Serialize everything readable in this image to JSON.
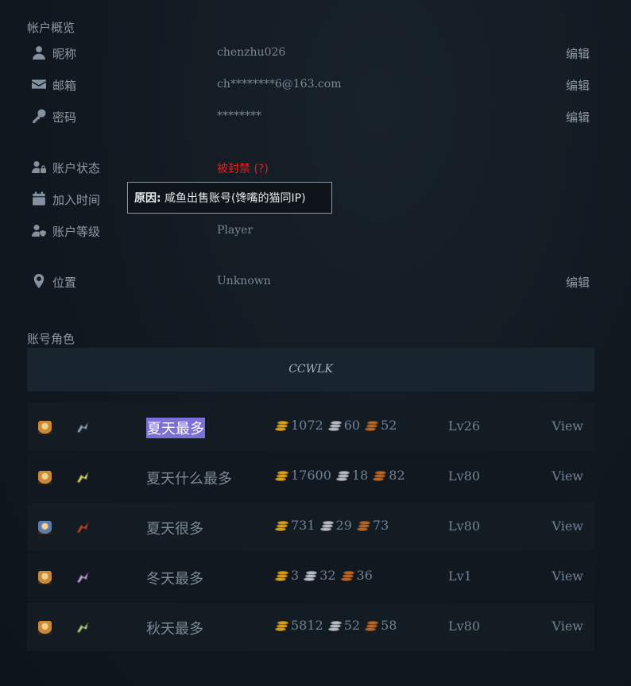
{
  "overview": {
    "title": "帐户概览",
    "rows": [
      {
        "label": "昵称",
        "value": "chenzhu026",
        "edit": "编辑",
        "icon": "user-icon"
      },
      {
        "label": "邮箱",
        "value": "ch********6@163.com",
        "edit": "编辑",
        "icon": "envelope-icon"
      },
      {
        "label": "密码",
        "value": "********",
        "edit": "编辑",
        "icon": "key-icon"
      }
    ],
    "status": {
      "label": "账户状态",
      "value": "被封禁 (?)",
      "icon": "user-lock-icon",
      "color": "#e2201e"
    },
    "joined": {
      "label": "加入时间",
      "icon": "calendar-icon"
    },
    "level": {
      "label": "账户等级",
      "value": "Player",
      "icon": "user-shield-icon"
    },
    "location": {
      "label": "位置",
      "value": "Unknown",
      "edit": "编辑",
      "icon": "map-marker-icon"
    }
  },
  "tooltip": {
    "prefix": "原因:",
    "text": " 咸鱼出售账号(馋嘴的猫同IP)"
  },
  "characters": {
    "title": "账号角色",
    "realm": "CCWLK",
    "list": [
      {
        "name": "夏天最多",
        "gold": "1072",
        "silver": "60",
        "copper": "52",
        "level": "Lv26",
        "view": "View",
        "selected": true,
        "race_icon": "human-female-icon",
        "class_icon": "class-icon-1"
      },
      {
        "name": "夏天什么最多",
        "gold": "17600",
        "silver": "18",
        "copper": "82",
        "level": "Lv80",
        "view": "View",
        "race_icon": "human-female-icon",
        "class_icon": "class-icon-2"
      },
      {
        "name": "夏天很多",
        "gold": "731",
        "silver": "29",
        "copper": "73",
        "level": "Lv80",
        "view": "View",
        "race_icon": "draenei-icon",
        "class_icon": "class-icon-3"
      },
      {
        "name": "冬天最多",
        "gold": "3",
        "silver": "32",
        "copper": "36",
        "level": "Lv1",
        "view": "View",
        "race_icon": "human-female-icon",
        "class_icon": "class-icon-4"
      },
      {
        "name": "秋天最多",
        "gold": "5812",
        "silver": "52",
        "copper": "58",
        "level": "Lv80",
        "view": "View",
        "race_icon": "human-female-icon",
        "class_icon": "class-icon-5"
      }
    ]
  },
  "colors": {
    "gold": "#d9a21b",
    "silver": "#b9bec4",
    "copper": "#b8672a",
    "banned": "#e2201e",
    "selection": "#7b6fd8"
  }
}
